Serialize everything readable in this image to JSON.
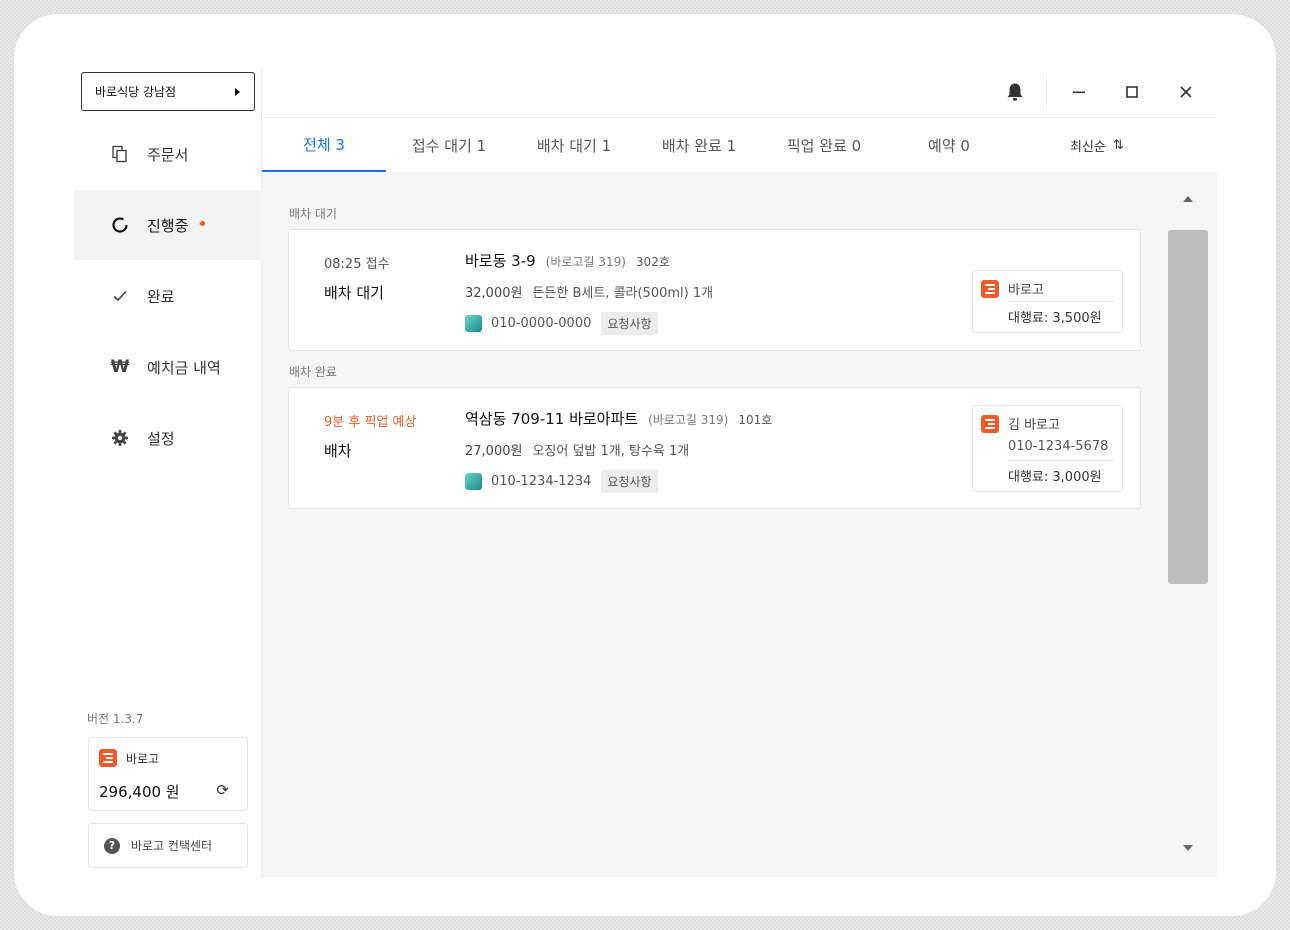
{
  "sidebar": {
    "store_name": "바로식당 강남점",
    "items": [
      {
        "label": "주문서"
      },
      {
        "label": "진행중"
      },
      {
        "label": "완료"
      },
      {
        "label": "예치금 내역"
      },
      {
        "label": "설정"
      }
    ],
    "version": "버전 1.3.7",
    "wallet": {
      "brand": "바로고",
      "balance": "296,400 원"
    },
    "support_label": "바로고 컨택센터"
  },
  "tabs": [
    {
      "label": "전체 3",
      "active": true
    },
    {
      "label": "접수 대기 1"
    },
    {
      "label": "배차 대기 1"
    },
    {
      "label": "배차 완료 1"
    },
    {
      "label": "픽업 완료 0"
    },
    {
      "label": "예약 0"
    }
  ],
  "sort_label": "최신순",
  "sections": [
    {
      "title": "배차 대기",
      "order": {
        "time": "08:25 접수",
        "status": "배차 대기",
        "address": "바로동 3-9",
        "road_address": "(바로고길 319)",
        "unit": "302호",
        "price": "32,000원",
        "items": "든든한 B세트, 콜라(500ml) 1개",
        "phone": "010-0000-0000",
        "request_label": "요청사항",
        "rider": {
          "name": "바로고",
          "fee": "대행료: 3,500원"
        }
      }
    },
    {
      "title": "배차 완료",
      "order": {
        "time": "9분 후 픽업 예상",
        "status": "배차",
        "address": "역삼동 709-11 바로아파트",
        "road_address": "(바로고길 319)",
        "unit": "101호",
        "price": "27,000원",
        "items": "오징어 덮밥 1개, 탕수육 1개",
        "phone": "010-1234-1234",
        "request_label": "요청사항",
        "rider": {
          "name": "김 바로고",
          "phone": "010-1234-5678",
          "fee": "대행료: 3,000원"
        }
      }
    }
  ],
  "colors": {
    "accent": "#1a73e8",
    "brand": "#f05a28",
    "warning_text": "#f05a28"
  },
  "icons": [
    "copy-icon",
    "progress-icon",
    "check-icon",
    "won-icon",
    "gear-icon",
    "bell-icon",
    "minimize-icon",
    "maximize-icon",
    "close-icon",
    "refresh-icon",
    "help-icon",
    "sort-icon",
    "barogo-logo-icon"
  ]
}
